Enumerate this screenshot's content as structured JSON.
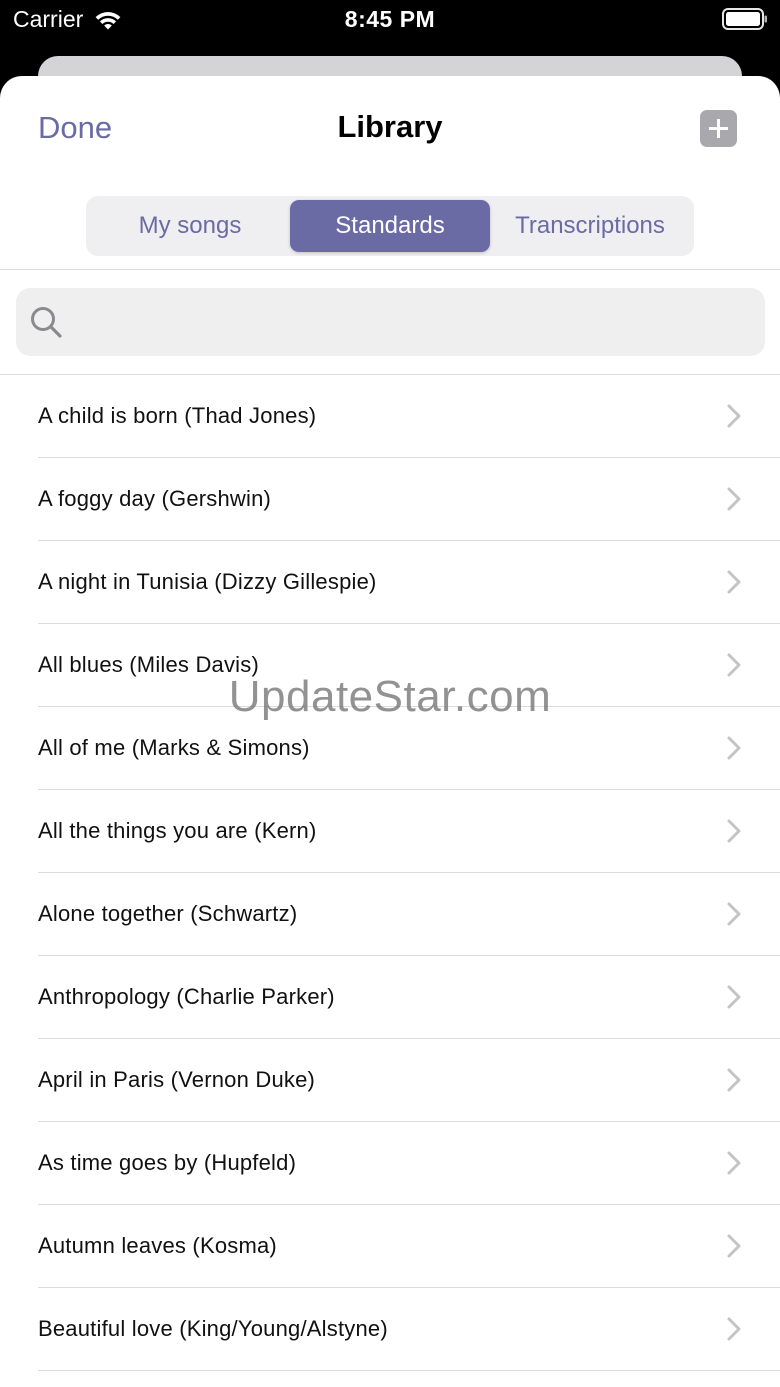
{
  "status_bar": {
    "carrier": "Carrier",
    "time": "8:45 PM"
  },
  "nav": {
    "done_label": "Done",
    "title": "Library",
    "add_icon": "plus-icon"
  },
  "tabs": [
    {
      "label": "My songs",
      "selected": false
    },
    {
      "label": "Standards",
      "selected": true
    },
    {
      "label": "Transcriptions",
      "selected": false
    }
  ],
  "search": {
    "value": "",
    "placeholder": ""
  },
  "songs": [
    "A child is born (Thad Jones)",
    "A foggy day (Gershwin)",
    "A night in Tunisia (Dizzy Gillespie)",
    "All blues (Miles Davis)",
    "All of me (Marks & Simons)",
    "All the things you are (Kern)",
    "Alone together (Schwartz)",
    "Anthropology (Charlie Parker)",
    "April in Paris (Vernon Duke)",
    "As time goes by (Hupfeld)",
    "Autumn leaves (Kosma)",
    "Beautiful love (King/Young/Alstyne)"
  ],
  "watermark": "UpdateStar.com",
  "colors": {
    "accent": "#6a6aa5",
    "separator": "#dcdcde",
    "search_bg": "#efeff0"
  }
}
